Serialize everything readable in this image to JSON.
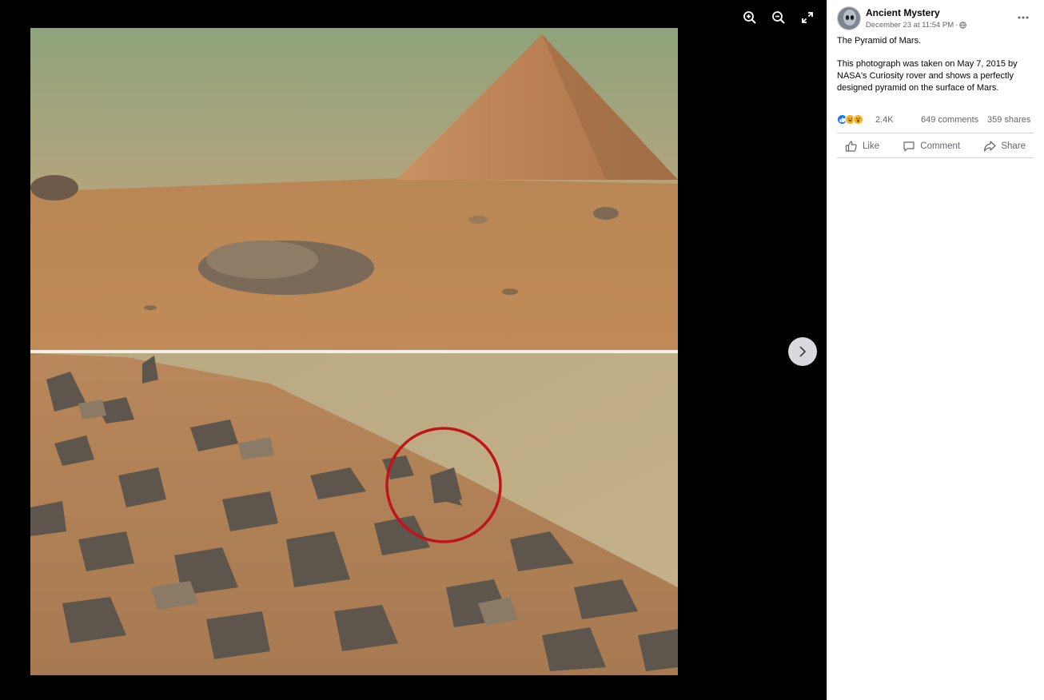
{
  "viewer": {
    "tools": [
      {
        "name": "zoom-in-icon"
      },
      {
        "name": "zoom-out-icon"
      },
      {
        "name": "fullscreen-icon"
      }
    ],
    "next_icon": "chevron-right-icon"
  },
  "post": {
    "author": "Ancient Mystery",
    "timestamp": "December 23 at 11:54 PM",
    "separator": "·",
    "privacy_icon": "globe-icon",
    "text_title": "The Pyramid of Mars.",
    "text_body": "This photograph was taken on May 7, 2015 by NASA's Curiosity rover and shows a perfectly designed pyramid on the surface of Mars."
  },
  "stats": {
    "reaction_count": "2.4K",
    "comments": "649 comments",
    "shares": "359 shares",
    "reaction_icons": [
      "like-icon",
      "haha-icon",
      "wow-icon"
    ]
  },
  "actions": {
    "like": "Like",
    "comment": "Comment",
    "share": "Share"
  },
  "colors": {
    "like_blue": "#1877f2",
    "reaction_yellow": "#f7b125",
    "muted_text": "#65676b"
  }
}
